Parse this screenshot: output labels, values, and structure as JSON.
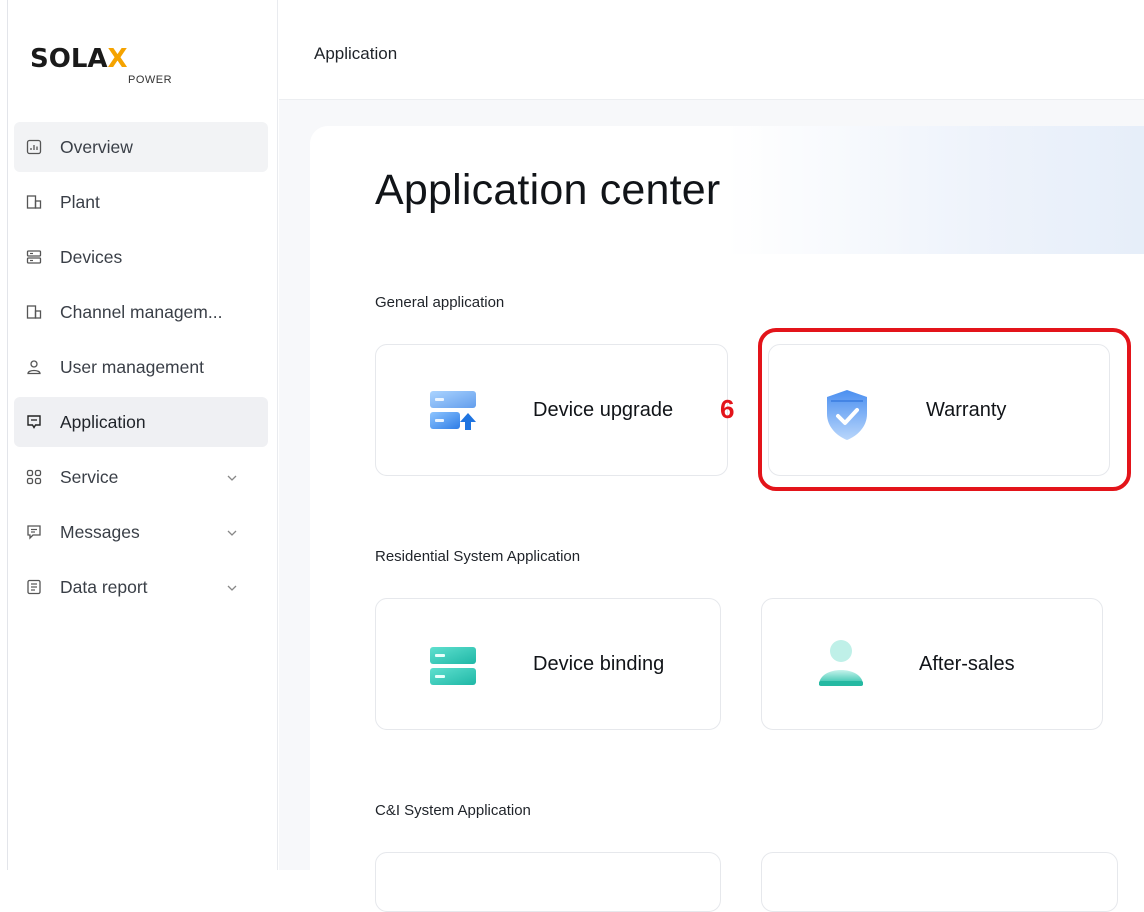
{
  "brand": {
    "main_before": "SOLA",
    "main_x": "X",
    "sub": "POWER"
  },
  "sidebar": {
    "items": [
      {
        "label": "Overview",
        "icon": "chart-box-icon",
        "state": "hover"
      },
      {
        "label": "Plant",
        "icon": "building-icon",
        "state": ""
      },
      {
        "label": "Devices",
        "icon": "server-icon",
        "state": ""
      },
      {
        "label": "Channel managem...",
        "icon": "building-icon",
        "state": ""
      },
      {
        "label": "User management",
        "icon": "user-icon",
        "state": ""
      },
      {
        "label": "Application",
        "icon": "application-icon",
        "state": "active"
      },
      {
        "label": "Service",
        "icon": "grid-icon",
        "state": "",
        "expandable": true
      },
      {
        "label": "Messages",
        "icon": "message-icon",
        "state": "",
        "expandable": true
      },
      {
        "label": "Data report",
        "icon": "report-icon",
        "state": "",
        "expandable": true
      }
    ]
  },
  "header": {
    "breadcrumb": "Application"
  },
  "main": {
    "title": "Application center",
    "sections": [
      {
        "title": "General application",
        "cards": [
          {
            "label": "Device upgrade",
            "icon": "device-upgrade-icon"
          },
          {
            "label": "Warranty",
            "icon": "shield-check-icon"
          }
        ]
      },
      {
        "title": "Residential System Application",
        "cards": [
          {
            "label": "Device binding",
            "icon": "device-binding-icon"
          },
          {
            "label": "After-sales",
            "icon": "after-sales-icon"
          }
        ]
      },
      {
        "title": "C&I System Application",
        "cards": []
      }
    ]
  },
  "annotation": {
    "number": "6"
  },
  "colors": {
    "accent": "#f5a300",
    "highlight": "#e3141a",
    "blue_icon": "#3b8cf0",
    "teal_icon": "#2ec4b6"
  }
}
